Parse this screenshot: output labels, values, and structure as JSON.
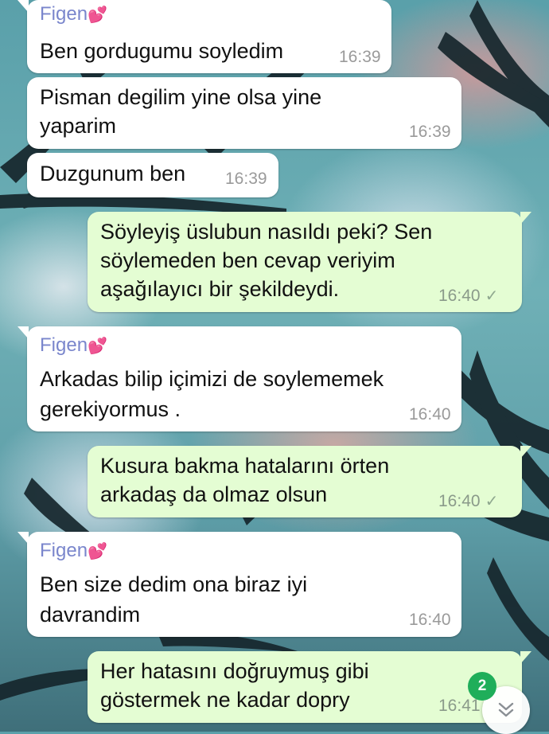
{
  "colors": {
    "incoming_bubble": "#ffffff",
    "outgoing_bubble": "#e4fdd3",
    "sender_name": "#7a86cc",
    "badge": "#1fae5a"
  },
  "icons": {
    "heart": "two-hearts-icon",
    "read_check": "check-icon",
    "scroll": "double-chevron-down-icon"
  },
  "messages": [
    {
      "direction": "in",
      "sender": "Figen",
      "lines": [
        "Ben gordugumu soyledim"
      ],
      "time": "16:39"
    },
    {
      "direction": "in",
      "lines": [
        "Pisman degilim yine olsa yine",
        "yaparim"
      ],
      "time": "16:39"
    },
    {
      "direction": "in",
      "lines": [
        "Duzgunum ben"
      ],
      "time": "16:39"
    },
    {
      "direction": "out",
      "lines": [
        "Söyleyiş üslubun nasıldı peki? Sen",
        "söylemeden ben cevap veriyim",
        "aşağılayıcı bir şekildeydi."
      ],
      "time": "16:40",
      "status": "✓"
    },
    {
      "direction": "in",
      "sender": "Figen",
      "lines": [
        "Arkadas bilip içimizi de soylememek",
        "gerekiyormus ."
      ],
      "time": "16:40"
    },
    {
      "direction": "out",
      "lines": [
        "Kusura bakma hatalarını örten",
        "arkadaş da olmaz olsun"
      ],
      "time": "16:40",
      "status": "✓"
    },
    {
      "direction": "in",
      "sender": "Figen",
      "lines": [
        "Ben size dedim ona biraz iyi",
        "davrandim"
      ],
      "time": "16:40"
    },
    {
      "direction": "out",
      "lines": [
        "Her hatasını doğruymuş gibi",
        "göstermek ne kadar dopry"
      ],
      "time": "16:41"
    }
  ],
  "unread_count": "2"
}
